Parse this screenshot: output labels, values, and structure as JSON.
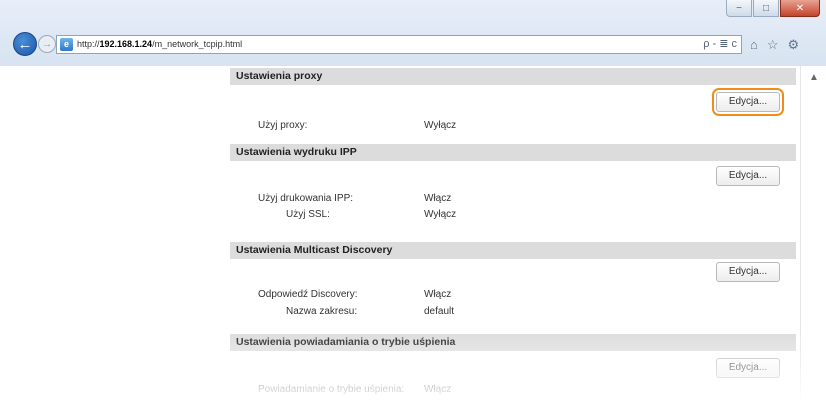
{
  "window": {
    "controls": [
      "−",
      "□",
      "✕"
    ]
  },
  "browser": {
    "back_icon": "back-arrow-icon",
    "forward_icon": "forward-arrow-icon",
    "url_prefix": "http://",
    "url_host": "192.168.1.24",
    "url_path": "/m_network_tcpip.html",
    "address_tools": "ρ - ≣ c",
    "toolbar_icons": [
      "home-icon",
      "star-icon",
      "gear-icon"
    ]
  },
  "sections": {
    "proxy": {
      "title": "Ustawienia proxy",
      "edit_label": "Edycja...",
      "rows": [
        {
          "label": "Użyj proxy:",
          "value": "Wyłącz"
        }
      ]
    },
    "ipp": {
      "title": "Ustawienia wydruku IPP",
      "edit_label": "Edycja...",
      "rows": [
        {
          "label": "Użyj drukowania IPP:",
          "value": "Włącz"
        },
        {
          "label": "Użyj SSL:",
          "value": "Wyłącz"
        }
      ]
    },
    "multicast": {
      "title": "Ustawienia Multicast Discovery",
      "edit_label": "Edycja...",
      "rows": [
        {
          "label": "Odpowiedź Discovery:",
          "value": "Włącz"
        },
        {
          "label": "Nazwa zakresu:",
          "value": "default"
        }
      ]
    },
    "sleep": {
      "title": "Ustawienia powiadamiania o trybie uśpienia",
      "edit_label": "Edycja...",
      "rows": [
        {
          "label": "Powiadamianie o trybie uśpienia:",
          "value": "Włącz"
        }
      ]
    }
  },
  "colors": {
    "highlight": "#f08c1a",
    "section_header_bg": "#dcdcdc"
  }
}
